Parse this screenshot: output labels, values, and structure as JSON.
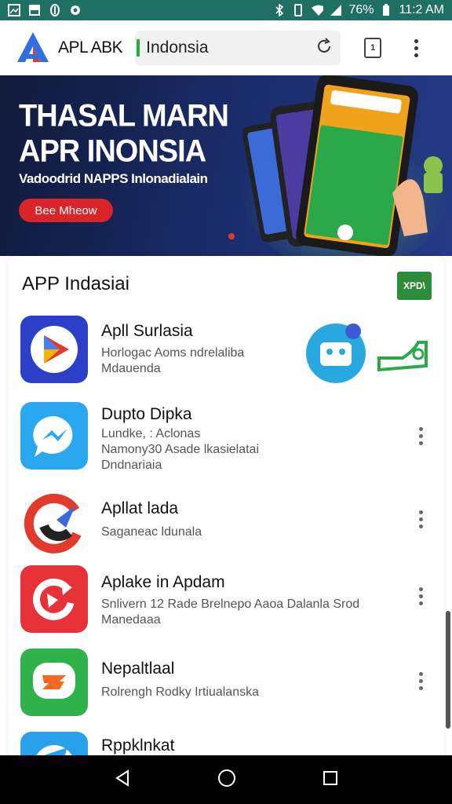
{
  "status_bar": {
    "battery": "76%",
    "time": "11:2 AM",
    "icons": [
      "gallery-icon",
      "image-icon",
      "notification-icon",
      "record-icon",
      "bluetooth-icon",
      "vibrate-icon",
      "wifi-icon",
      "signal-icon",
      "battery-icon"
    ]
  },
  "browser": {
    "brand": "APL ABK",
    "url": "Indonsia",
    "icons": [
      "app-logo-icon",
      "reload-icon",
      "tabs-icon",
      "overflow-menu-icon"
    ]
  },
  "banner": {
    "title_line1": "THASAL MARN",
    "title_line2": "APR INONSIA",
    "subtitle": "Vadoodrid NAPPS Inlonadialain",
    "button": "Bee Mheow"
  },
  "section": {
    "title": "APP Indasiai",
    "badge": "XPD\\"
  },
  "apps": [
    {
      "name": "Apll Surlasia",
      "desc": [
        "Horlogac Aoms ndrelaliba",
        "Mdauenda"
      ],
      "icon": "play-triangle-icon"
    },
    {
      "name": "Dupto Dipka",
      "desc": [
        "Lundke, : Aclonas",
        "Namony30 Asade lkasielatai",
        "Dndnariaia"
      ],
      "icon": "messenger-icon"
    },
    {
      "name": "Apllat lada",
      "desc": [
        "Saganeac ldunala"
      ],
      "icon": "swirl-icon"
    },
    {
      "name": "Aplake in Apdam",
      "desc": [
        "Snlivern 12 Rade Brelnepo Aaoa Dalanla Srod",
        "Manedaaa"
      ],
      "icon": "refresh-app-icon"
    },
    {
      "name": "Nepaltlaal",
      "desc": [
        "Rolrengh Rodky Irtiualanska"
      ],
      "icon": "chat-app-icon"
    },
    {
      "name": "Rppklnkat",
      "desc": [],
      "icon": "blue-app-icon"
    }
  ],
  "nav": {
    "icons": [
      "back-icon",
      "home-icon",
      "recents-icon"
    ]
  },
  "colors": {
    "status_bar": "#1f6f63",
    "banner_start": "#101a3a",
    "banner_end": "#243a86",
    "banner_button": "#d9252a",
    "badge": "#2e8b3c"
  }
}
